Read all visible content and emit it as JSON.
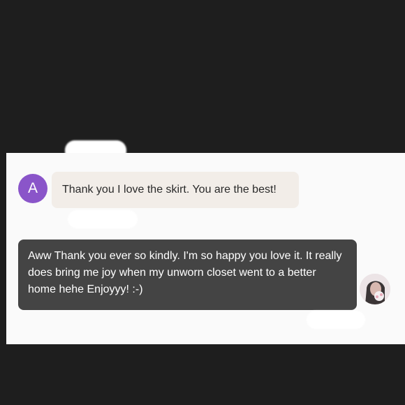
{
  "received_message": {
    "avatar_initial": "A",
    "text": "Thank you I love the skirt. You are the best!"
  },
  "sent_message": {
    "text": "Aww Thank you ever so kindly. I'm so happy you love it. It really does bring me joy when my unworn closet went to a better home hehe Enjoyyy! :-)"
  },
  "colors": {
    "avatar_bg": "#8a55c9",
    "incoming_bubble": "#f2ede8",
    "outgoing_bubble": "#444444",
    "background": "#1e1e1e"
  }
}
